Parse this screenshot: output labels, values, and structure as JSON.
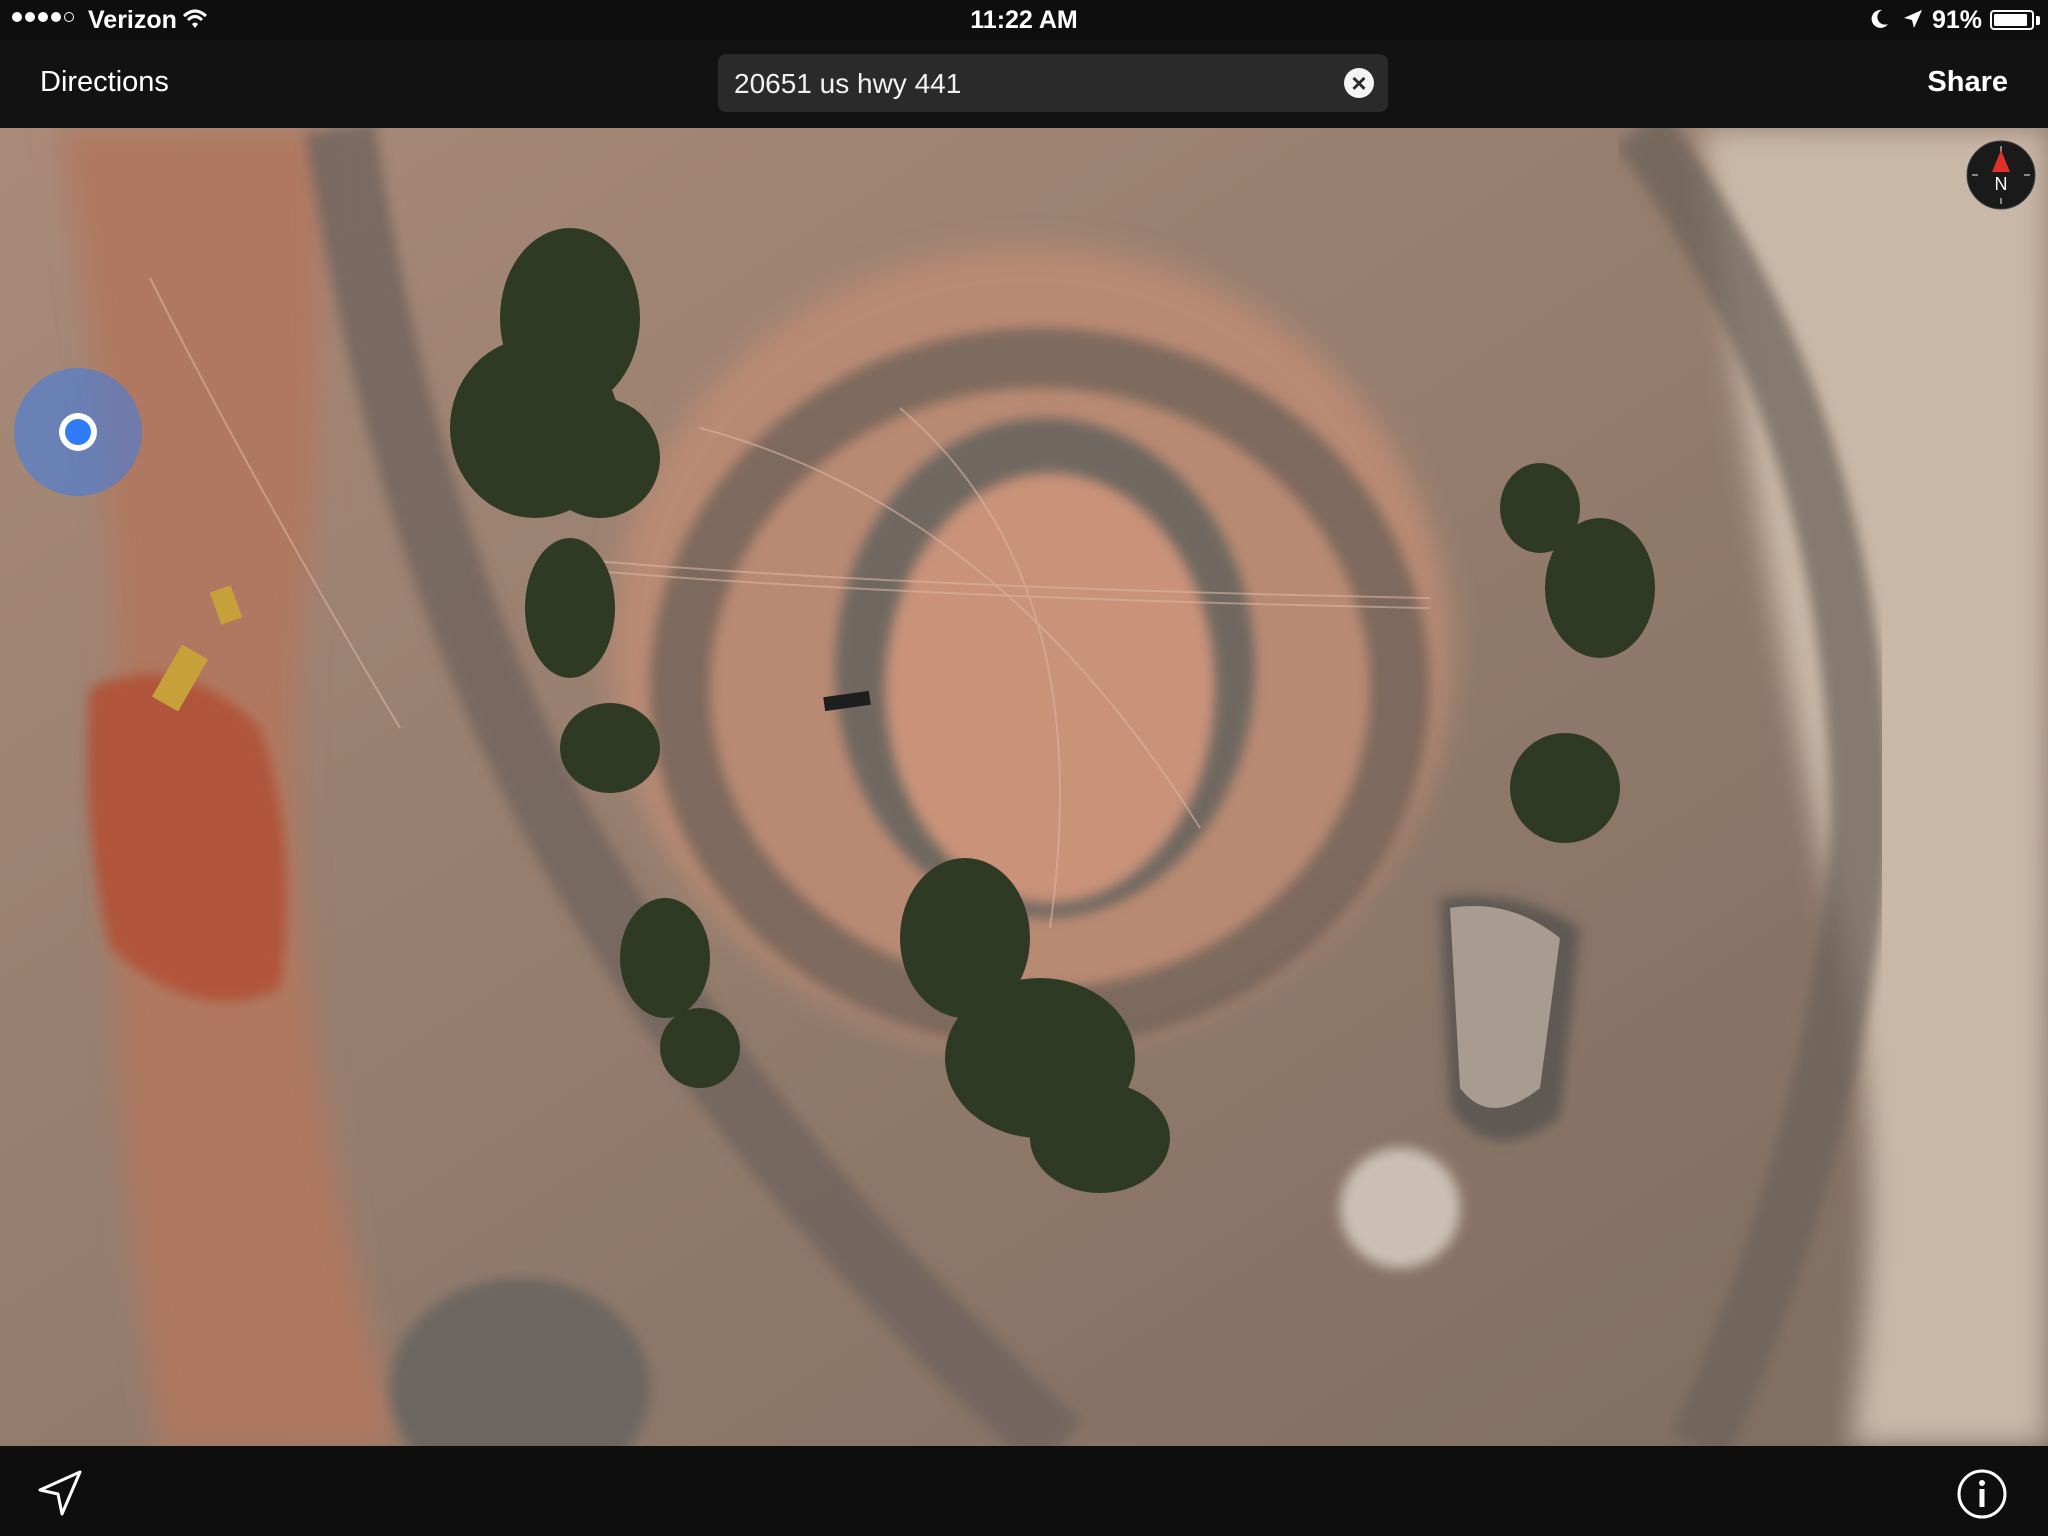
{
  "status_bar": {
    "carrier": "Verizon",
    "time": "11:22 AM",
    "battery_percent": "91%",
    "battery_level": 0.91,
    "signal_bars_filled": 4,
    "signal_bars_total": 5,
    "icons": [
      "wifi-icon",
      "moon-icon",
      "location-arrow-icon",
      "battery-icon"
    ]
  },
  "nav_bar": {
    "directions_label": "Directions",
    "share_label": "Share",
    "search_value": "20651 us hwy 441",
    "clear_icon": "clear-circle-icon"
  },
  "map": {
    "mode": "satellite",
    "compass_label": "N",
    "user_location_icon": "current-location-icon"
  },
  "toolbar": {
    "locate_icon": "location-arrow-icon",
    "info_icon": "info-icon"
  },
  "colors": {
    "bar_background": "#0e0e0e",
    "search_field": "#2a2a2a",
    "location_blue": "#2f7cf6",
    "compass_red": "#e0302a"
  }
}
